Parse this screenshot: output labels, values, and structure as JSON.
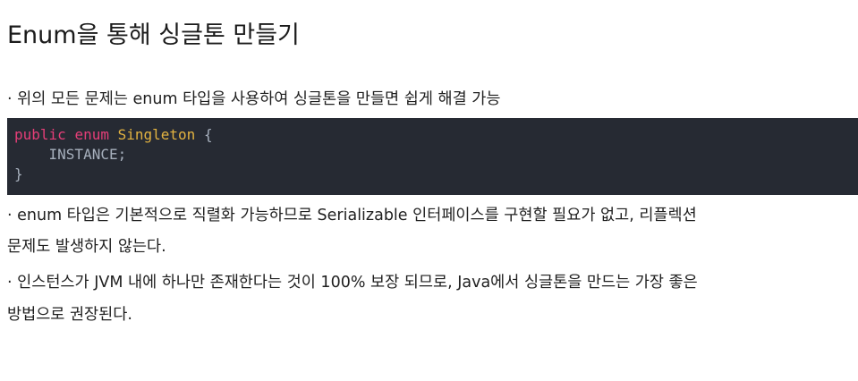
{
  "title": "Enum을 통해 싱글톤 만들기",
  "bullets": [
    {
      "lines": [
        "· 위의 모든 문제는 enum 타입을 사용하여 싱글톤을 만들면 쉽게 해결 가능"
      ]
    },
    {
      "lines": [
        "· enum 타입은 기본적으로 직렬화 가능하므로 Serializable 인터페이스를 구현할 필요가 없고, 리플렉션",
        "문제도 발생하지 않는다."
      ]
    },
    {
      "lines": [
        "· 인스턴스가 JVM 내에 하나만 존재한다는 것이 100% 보장 되므로, Java에서 싱글톤을 만드는 가장 좋은",
        "방법으로 권장된다."
      ]
    }
  ],
  "code": {
    "kw_public": "public",
    "kw_enum": "enum",
    "class_name": "Singleton",
    "open_brace": "{",
    "indent": "    ",
    "constant": "INSTANCE;",
    "close_brace": "}"
  },
  "colors": {
    "code_background": "#262a33",
    "keyword": "#e53e78",
    "class_name": "#e3b341",
    "code_text": "#a7b0bd"
  }
}
